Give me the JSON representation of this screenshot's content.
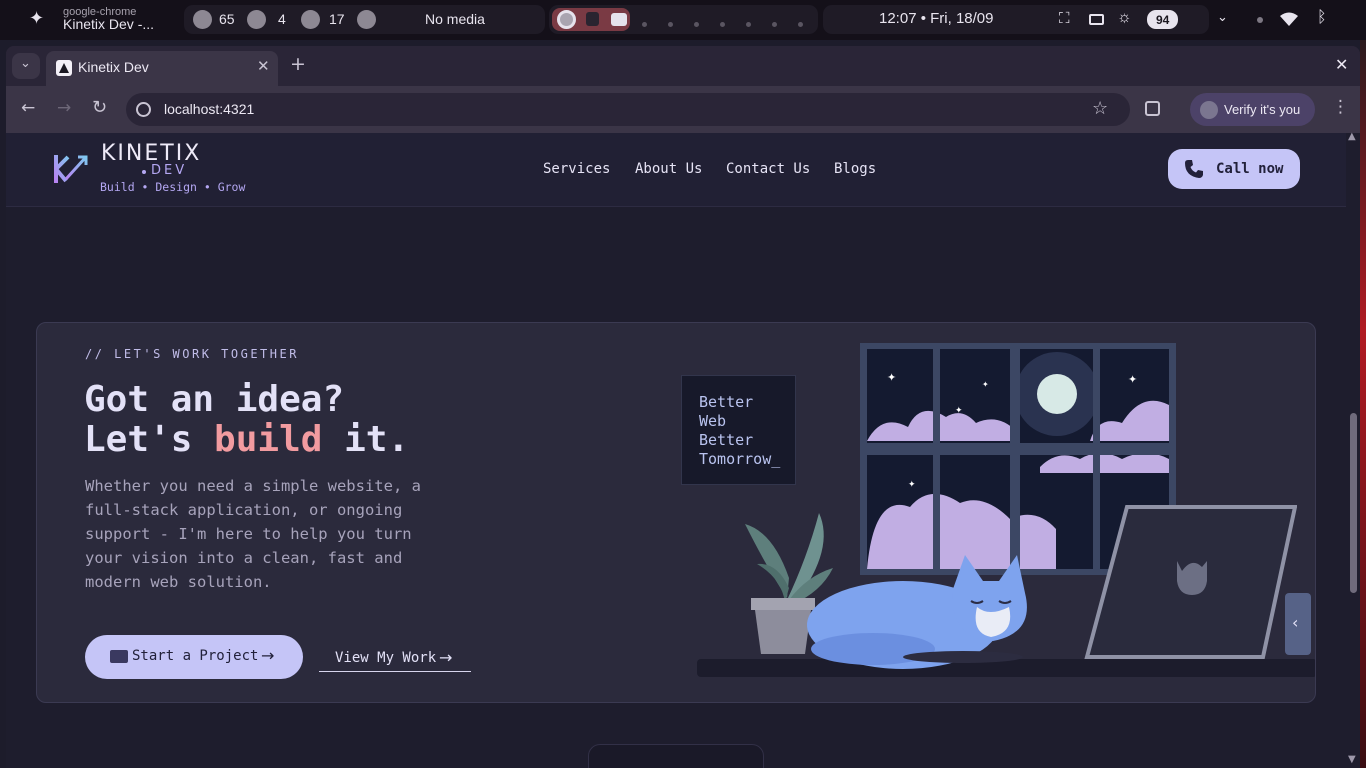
{
  "os": {
    "app_name": "google-chrome",
    "window_title": "Kinetix Dev -...",
    "stat_cpu": "65",
    "stat_updates": "4",
    "stat_activity": "17",
    "media": "No media",
    "clock": "12:07 • Fri, 18/09",
    "battery": "94"
  },
  "browser": {
    "tab_title": "Kinetix Dev",
    "url": "localhost:4321",
    "verify_label": "Verify it's you"
  },
  "site": {
    "logo_title": "KINETIX",
    "logo_sub": "DEV",
    "tagline": "Build • Design • Grow",
    "nav": [
      "Services",
      "About Us",
      "Contact Us",
      "Blogs"
    ],
    "call_label": "Call now"
  },
  "hero": {
    "kicker": "// LET'S WORK TOGETHER",
    "headline_line1": "Got an idea?",
    "headline_line2_pre": "Let's ",
    "headline_line2_accent": "build",
    "headline_line2_post": " it.",
    "body_lines": [
      "Whether you need a simple website, a",
      "full-stack application, or ongoing",
      "support - I'm here to help you turn",
      "your vision into a clean, fast and",
      "modern web solution."
    ],
    "start_label": "Start a Project",
    "work_label": "View My Work",
    "poster_lines": [
      "Better",
      "Web",
      "Better",
      "Tomorrow_"
    ]
  },
  "colors": {
    "accent_lavender": "#c5c5f7",
    "accent_pink": "#f29ba0",
    "page_bg": "#1e1d2d",
    "card_bg": "#2b2a3c"
  }
}
